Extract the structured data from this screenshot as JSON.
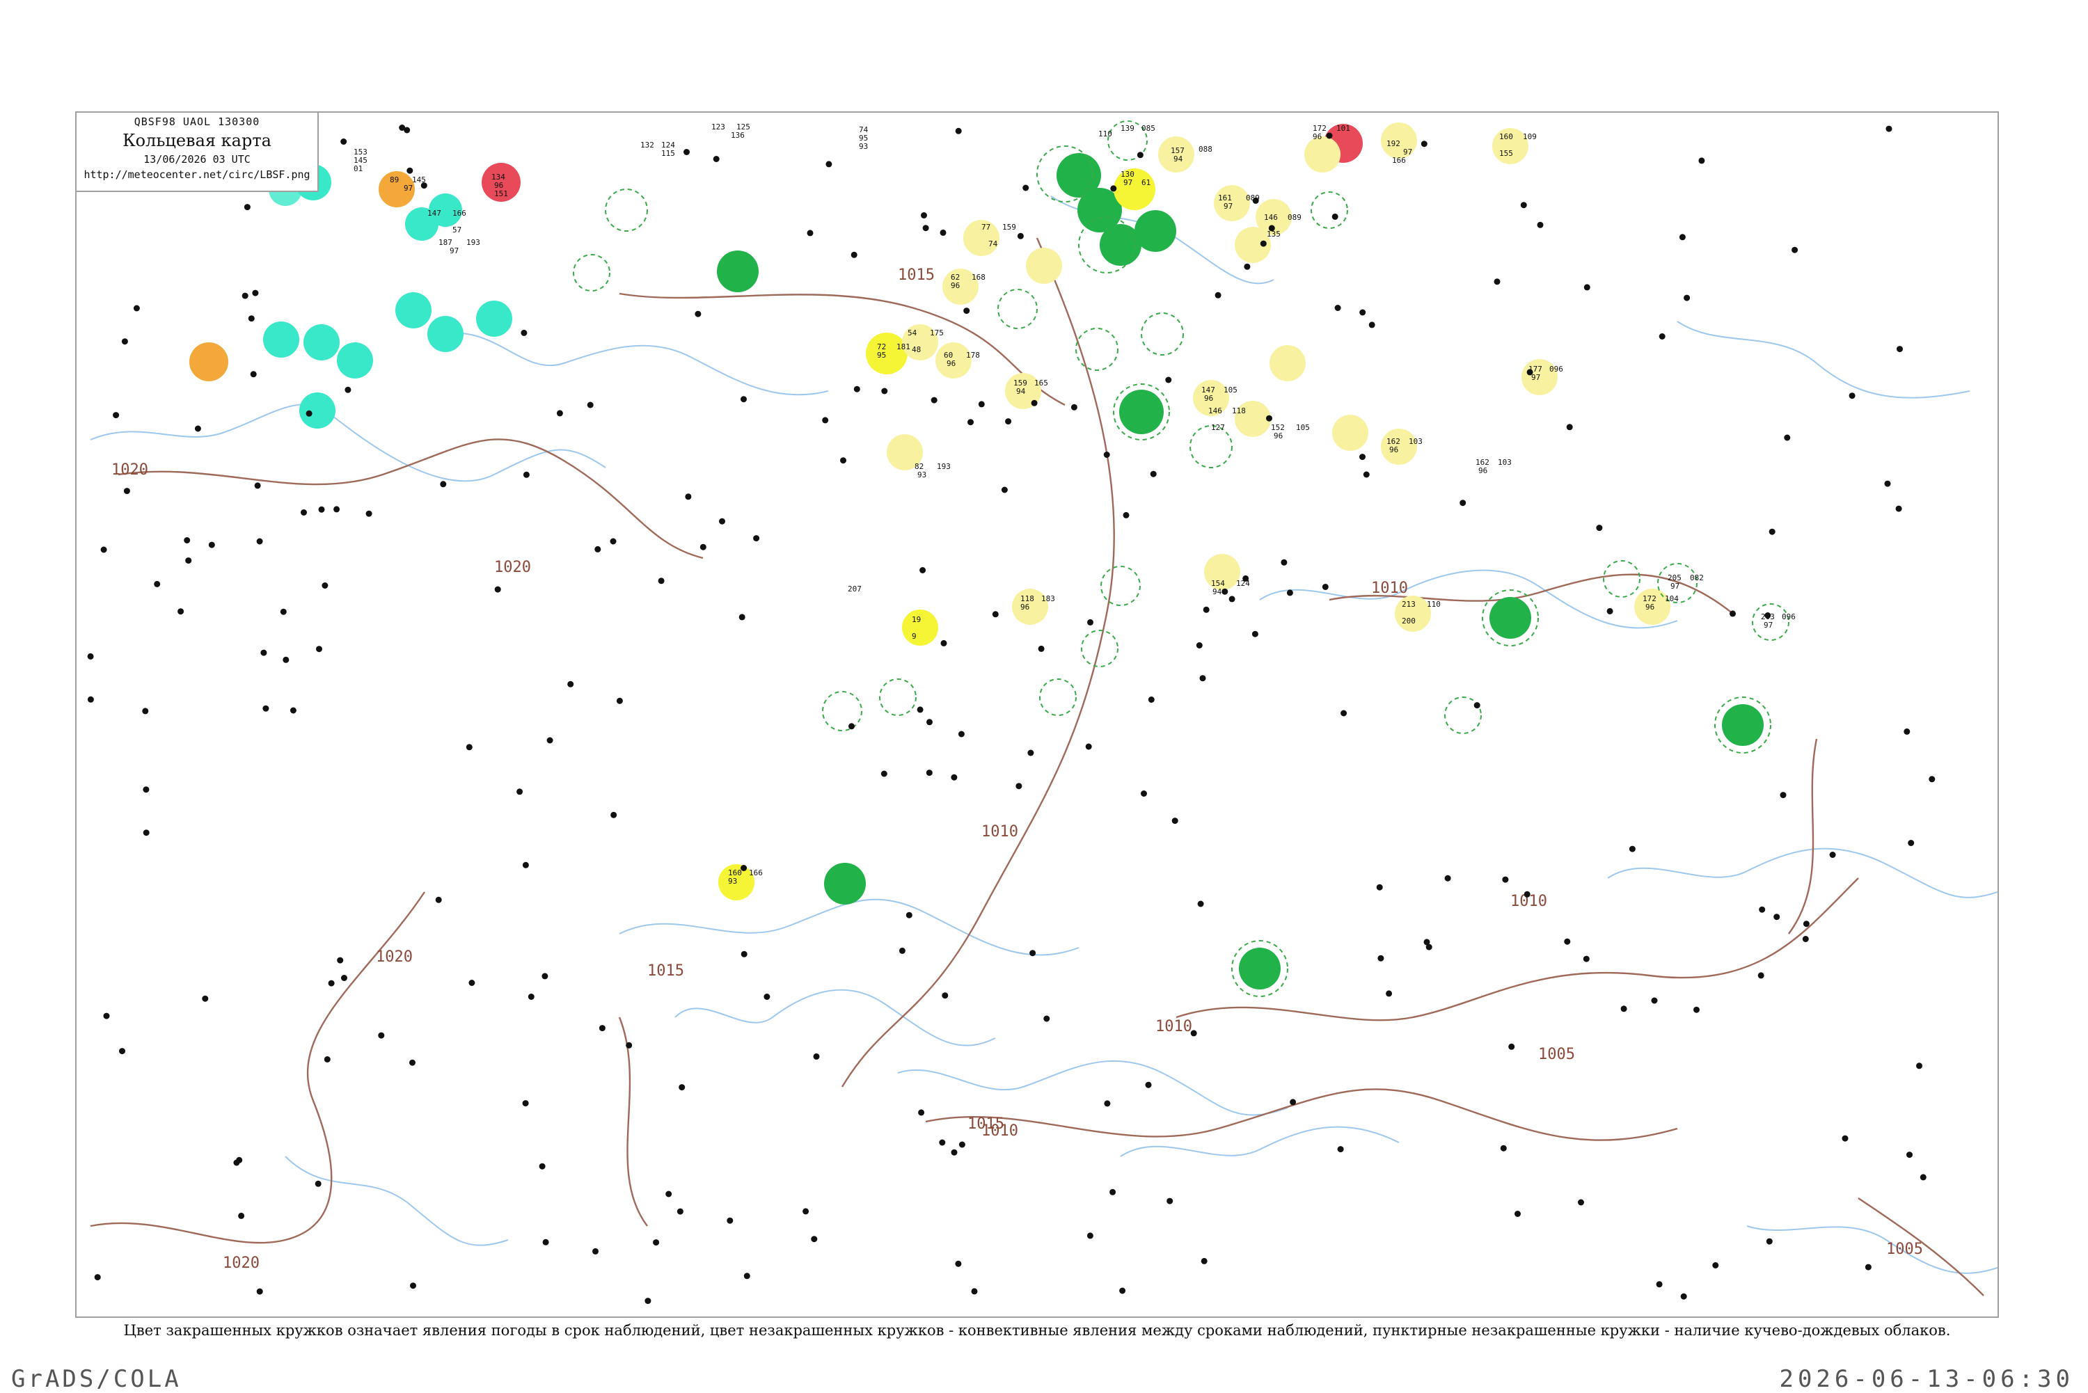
{
  "header": {
    "code_line": "QBSF98  UAOL  130300",
    "title": "Кольцевая карта",
    "time": "13/06/2026 03 UTC",
    "url": "http://meteocenter.net/circ/LBSF.png"
  },
  "legend_caption": "Цвет закрашенных кружков означает явления погоды в срок наблюдений, цвет незакрашенных кружков - конвективные явления между сроками наблюдений, пунктирные незакрашенные кружки - наличие кучево-дождевых облаков.",
  "footer": {
    "left": "GrADS/COLA",
    "right": "2026-06-13-06:30"
  },
  "colors": {
    "green": "#22b24a",
    "yellow": "#f5f536",
    "light_yellow": "#f8f2a0",
    "cyan": "#38e8c8",
    "orange": "#f5a83a",
    "red": "#e84a5a",
    "isobar": "#a06a5a",
    "water": "#9ec8ee",
    "dashed_green": "#3aaa4a"
  },
  "isobar_labels": [
    "1015",
    "1020",
    "1010",
    "1015",
    "1020",
    "1010",
    "1015",
    "1010",
    "1010",
    "1005",
    "1005",
    "1020",
    "1010",
    "1020"
  ],
  "stations": [
    {
      "t": "153",
      "td": "145",
      "p": "01",
      "cls": "cyan"
    },
    {
      "t": "89",
      "td": "145",
      "p": "97",
      "cls": "orange"
    },
    {
      "t": "134",
      "td": "96",
      "p": "151",
      "cls": "red"
    },
    {
      "t": "187",
      "td": "193",
      "p": "97",
      "cls": "none"
    },
    {
      "t": "132",
      "td": "124",
      "p": "115",
      "cls": "none"
    },
    {
      "t": "123",
      "td": "125",
      "p": "136",
      "cls": "none"
    },
    {
      "t": "74",
      "td": "95",
      "p": "93",
      "cls": "none"
    },
    {
      "t": "110",
      "td": "139",
      "p": "085",
      "cls": "dashed"
    },
    {
      "t": "157",
      "td": "088",
      "p": "94",
      "cls": "light_yellow"
    },
    {
      "t": "172",
      "td": "101",
      "p": "96",
      "cls": "light_yellow"
    },
    {
      "t": "192",
      "td": "166",
      "p": "97",
      "cls": "light_yellow"
    },
    {
      "t": "160",
      "td": "155",
      "p": "109",
      "cls": "light_yellow"
    },
    {
      "t": "147",
      "td": "166",
      "p": "57",
      "cls": "cyan"
    },
    {
      "t": "77",
      "td": "159",
      "p": "74",
      "cls": "light_yellow"
    },
    {
      "t": "130",
      "td": "61",
      "p": "97",
      "cls": "yellow"
    },
    {
      "t": "161",
      "td": "089",
      "p": "97",
      "cls": "light_yellow"
    },
    {
      "t": "146",
      "td": "089",
      "p": "135",
      "cls": "light_yellow"
    },
    {
      "t": "62",
      "td": "168",
      "p": "96",
      "cls": "light_yellow"
    },
    {
      "t": "54",
      "td": "175",
      "p": "48",
      "cls": "light_yellow"
    },
    {
      "t": "72",
      "td": "181",
      "p": "95",
      "cls": "yellow"
    },
    {
      "t": "60",
      "td": "178",
      "p": "96",
      "cls": "light_yellow"
    },
    {
      "t": "159",
      "td": "165",
      "p": "94",
      "cls": "light_yellow"
    },
    {
      "t": "147",
      "td": "105",
      "p": "96",
      "cls": "light_yellow"
    },
    {
      "t": "146",
      "td": "118",
      "p": "127",
      "cls": "light_yellow"
    },
    {
      "t": "152",
      "td": "105",
      "p": "96",
      "cls": "light_yellow"
    },
    {
      "t": "162",
      "td": "103",
      "p": "96",
      "cls": "light_yellow"
    },
    {
      "t": "177",
      "td": "096",
      "p": "97",
      "cls": "light_yellow"
    },
    {
      "t": "82",
      "td": "193",
      "p": "93",
      "cls": "light_yellow"
    },
    {
      "t": "154",
      "td": "124",
      "p": "94",
      "cls": "light_yellow"
    },
    {
      "t": "118",
      "td": "183",
      "p": "96",
      "cls": "light_yellow"
    },
    {
      "t": "19",
      "td": "207",
      "p": "9",
      "cls": "yellow"
    },
    {
      "t": "213",
      "td": "110",
      "p": "200",
      "cls": "light_yellow"
    },
    {
      "t": "172",
      "td": "104",
      "p": "96",
      "cls": "light_yellow"
    },
    {
      "t": "160",
      "td": "166",
      "p": "93",
      "cls": "yellow"
    },
    {
      "t": "162",
      "td": "103",
      "p": "96",
      "cls": "none"
    },
    {
      "t": "203",
      "td": "096",
      "p": "97",
      "cls": "dashed"
    },
    {
      "t": "205",
      "td": "082",
      "p": "97",
      "cls": "dashed"
    }
  ]
}
